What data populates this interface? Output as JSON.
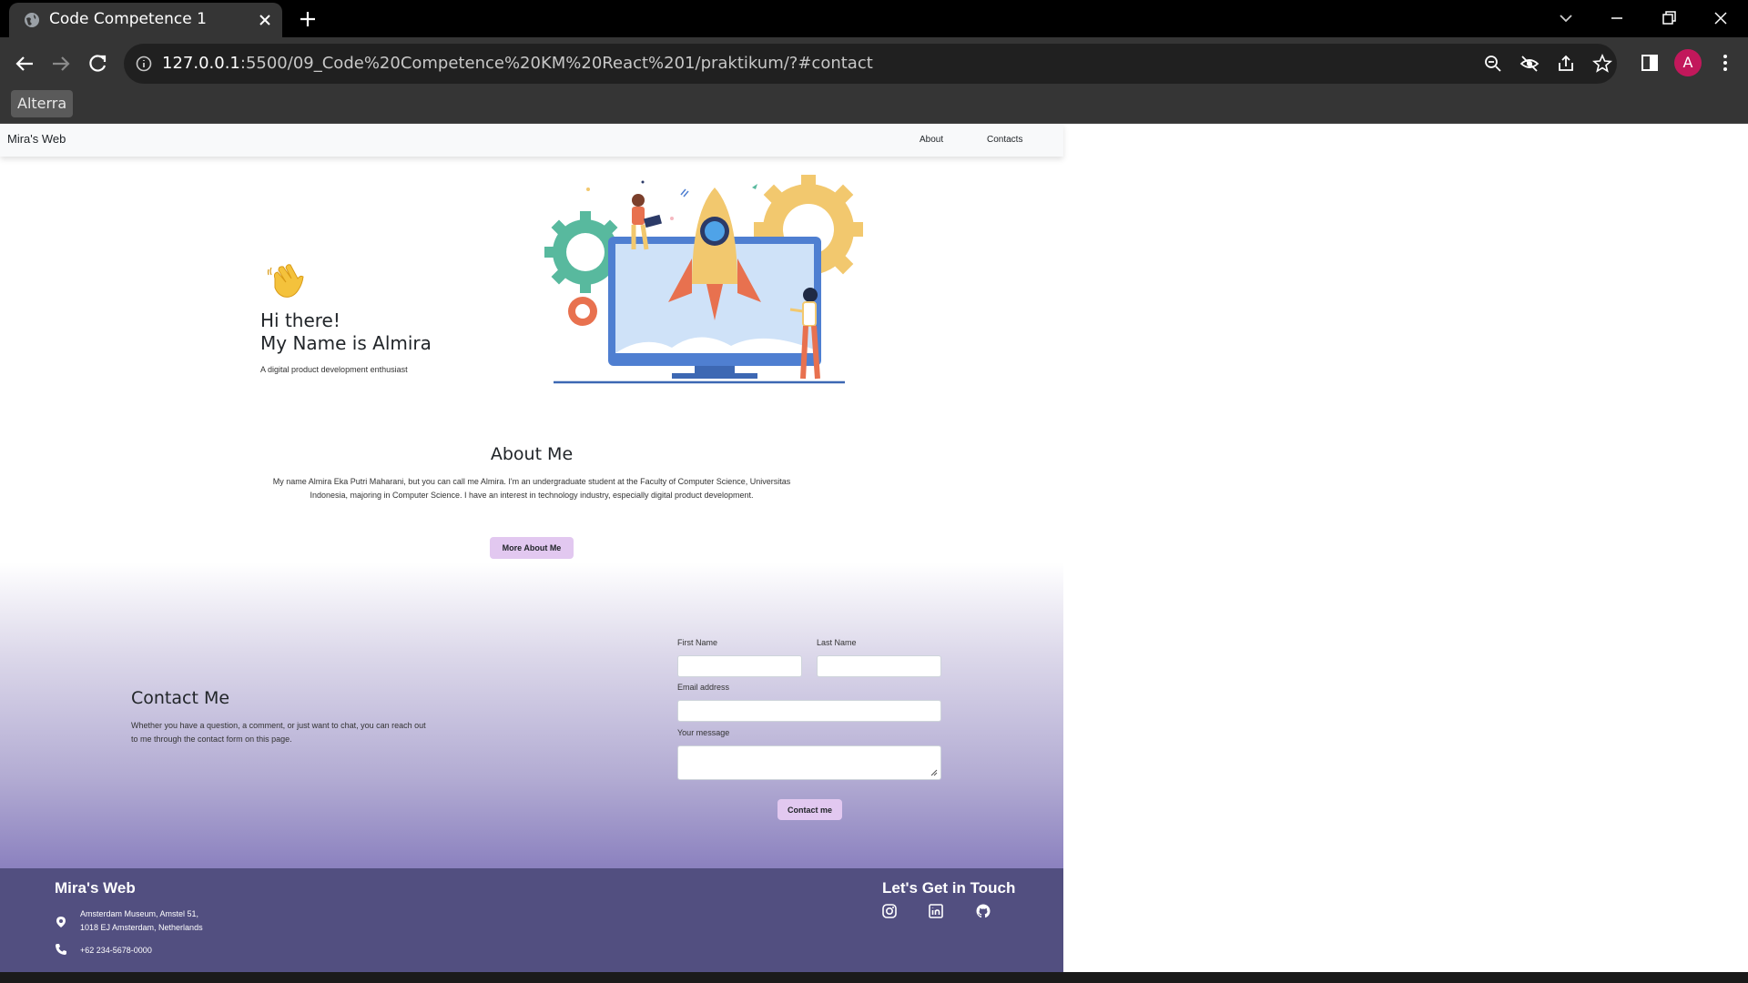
{
  "browser": {
    "tab_title": "Code Competence 1",
    "url_host": "127.0.0.1",
    "url_rest": ":5500/09_Code%20Competence%20KM%20React%201/praktikum/?#contact",
    "bookmark": "Alterra",
    "profile_initial": "A",
    "accent_profile_color": "#c2185b"
  },
  "nav": {
    "brand": "Mira's Web",
    "links": [
      "About",
      "Contacts"
    ]
  },
  "hero": {
    "line1": "Hi there!",
    "line2": "My Name is Almira",
    "subtitle": "A digital product development enthusiast"
  },
  "about": {
    "title": "About Me",
    "text": "My name Almira Eka Putri Maharani, but you can call me Almira. I'm an undergraduate student at the Faculty of Computer Science, Universitas Indonesia, majoring in Computer Science. I have an interest in technology industry, especially digital product development.",
    "button": "More About Me"
  },
  "contact": {
    "title": "Contact Me",
    "description": "Whether you have a question, a comment, or just want to chat, you can reach out to me through the contact form on this page.",
    "first_name_label": "First Name",
    "last_name_label": "Last Name",
    "email_label": "Email address",
    "message_label": "Your message",
    "first_name_value": "",
    "last_name_value": "",
    "email_value": "",
    "message_value": "",
    "button": "Contact me"
  },
  "footer": {
    "brand": "Mira's Web",
    "address_line1": "Amsterdam Museum, Amstel 51,",
    "address_line2": "1018 EJ Amsterdam, Netherlands",
    "phone": "+62 234-5678-0000",
    "touch_title": "Let's Get in Touch",
    "socials": [
      "instagram-icon",
      "linkedin-icon",
      "github-icon"
    ]
  },
  "colors": {
    "button_bg": "#e2c8f0",
    "footer_bg": "#524f80",
    "gradient_end": "#8b81bf"
  }
}
